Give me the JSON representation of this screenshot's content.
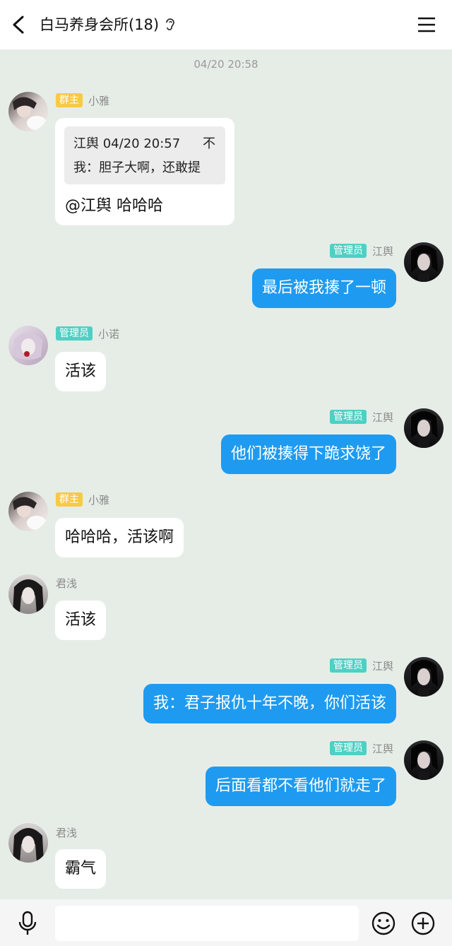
{
  "header": {
    "title": "白马养身会所(18)",
    "back_icon": "back-arrow-icon",
    "ear_icon": "ear-icon",
    "menu_icon": "menu-icon"
  },
  "timestamp": "04/20 20:58",
  "messages": [
    {
      "sender": "小雅",
      "role": "群主",
      "side": "left",
      "quote": {
        "author_time": "江舆 04/20 20:57",
        "text": "我：胆子大啊，还敢提",
        "close": "不"
      },
      "text": "@江舆 哈哈哈"
    },
    {
      "sender": "江舆",
      "role": "管理员",
      "side": "right",
      "text": "最后被我揍了一顿"
    },
    {
      "sender": "小诺",
      "role": "管理员",
      "side": "left",
      "text": "活该"
    },
    {
      "sender": "江舆",
      "role": "管理员",
      "side": "right",
      "text": "他们被揍得下跪求饶了"
    },
    {
      "sender": "小雅",
      "role": "群主",
      "side": "left",
      "text": "哈哈哈，活该啊"
    },
    {
      "sender": "君浅",
      "role": "",
      "side": "left",
      "text": "活该"
    },
    {
      "sender": "江舆",
      "role": "管理员",
      "side": "right",
      "text": "我：君子报仇十年不晚，你们活该"
    },
    {
      "sender": "江舆",
      "role": "管理员",
      "side": "right",
      "text": "后面看都不看他们就走了"
    },
    {
      "sender": "君浅",
      "role": "",
      "side": "left",
      "text": "霸气"
    }
  ],
  "input_bar": {
    "mic_icon": "microphone-icon",
    "input_value": "",
    "emoji_icon": "emoji-icon",
    "plus_icon": "plus-icon"
  },
  "colors": {
    "background": "#e6ede7",
    "outgoing_bubble": "#1e9bf0",
    "owner_badge": "#f7c945",
    "admin_badge": "#4fd0c4"
  }
}
